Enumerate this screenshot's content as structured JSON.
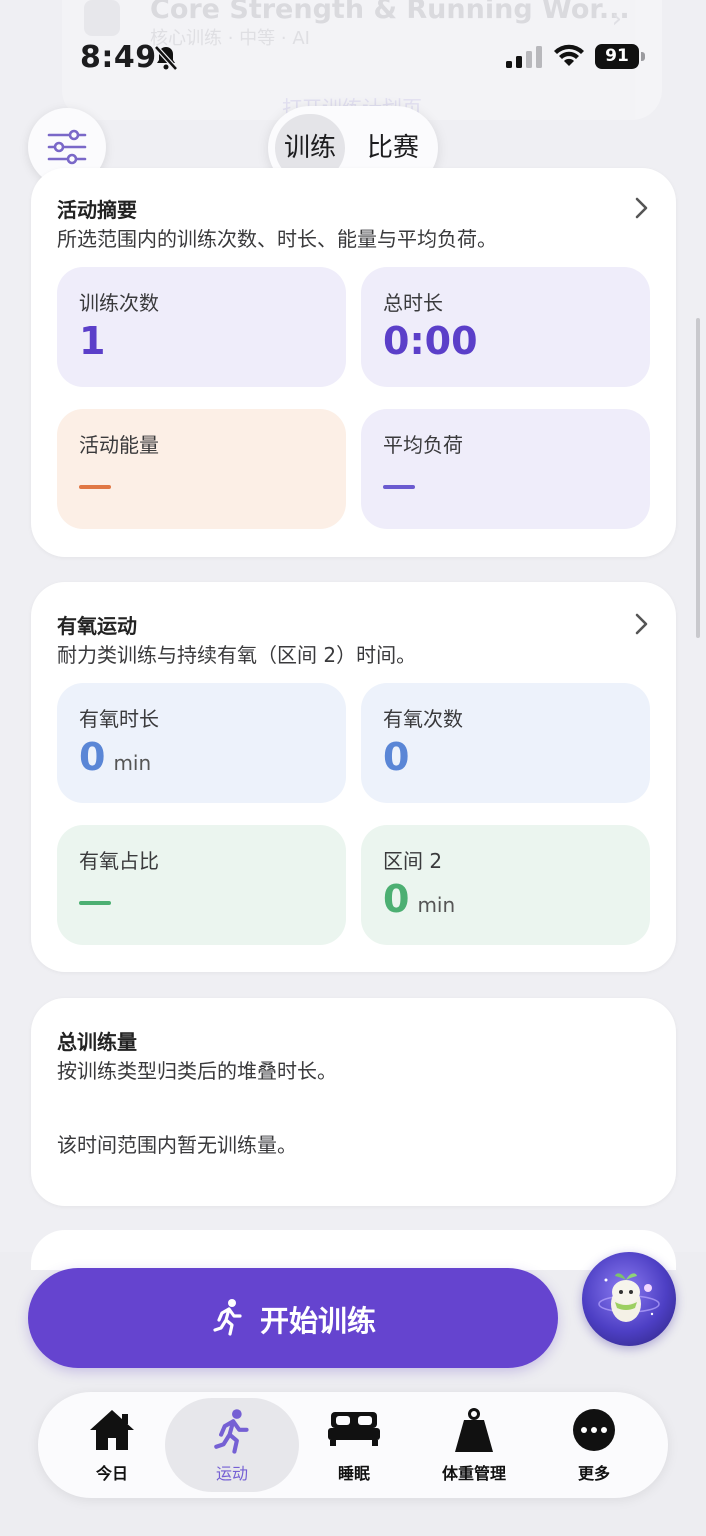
{
  "background_content": {
    "title": "Core Strength & Running Wor...",
    "subtitle": "核心训练 · 中等 · AI",
    "link": "打开训练计划页"
  },
  "status_bar": {
    "time": "8:49",
    "battery": "91"
  },
  "segmented": {
    "options": [
      "训练",
      "比赛"
    ],
    "selected": "训练"
  },
  "activity_summary": {
    "title": "活动摘要",
    "subtitle": "所选范围内的训练次数、时长、能量与平均负荷。",
    "tiles": [
      {
        "label": "训练次数",
        "value": "1",
        "color": "#5b3fc9"
      },
      {
        "label": "总时长",
        "value": "0:00",
        "color": "#5b3fc9"
      },
      {
        "label": "活动能量",
        "value": "—",
        "color": "#e07845"
      },
      {
        "label": "平均负荷",
        "value": "—",
        "color": "#6b5bd0"
      }
    ]
  },
  "aerobic": {
    "title": "有氧运动",
    "subtitle": "耐力类训练与持续有氧（区间 2）时间。",
    "tiles": [
      {
        "label": "有氧时长",
        "value": "0",
        "unit": "min",
        "color": "#5a86d6"
      },
      {
        "label": "有氧次数",
        "value": "0",
        "color": "#5a86d6"
      },
      {
        "label": "有氧占比",
        "value": "—",
        "color": "#4caf72"
      },
      {
        "label": "区间 2",
        "value": "0",
        "unit": "min",
        "color": "#4caf72"
      }
    ]
  },
  "training_volume": {
    "title": "总训练量",
    "subtitle": "按训练类型归类后的堆叠时长。",
    "empty": "该时间范围内暂无训练量。"
  },
  "start_button": {
    "label": "开始训练"
  },
  "tabbar": {
    "tabs": [
      {
        "label": "今日",
        "icon": "home-icon"
      },
      {
        "label": "运动",
        "icon": "run-icon"
      },
      {
        "label": "睡眠",
        "icon": "bed-icon"
      },
      {
        "label": "体重管理",
        "icon": "weight-icon"
      },
      {
        "label": "更多",
        "icon": "more-icon"
      }
    ],
    "selected": "运动"
  },
  "colors": {
    "accent": "#6544cf",
    "tab_active": "#7560d4"
  }
}
